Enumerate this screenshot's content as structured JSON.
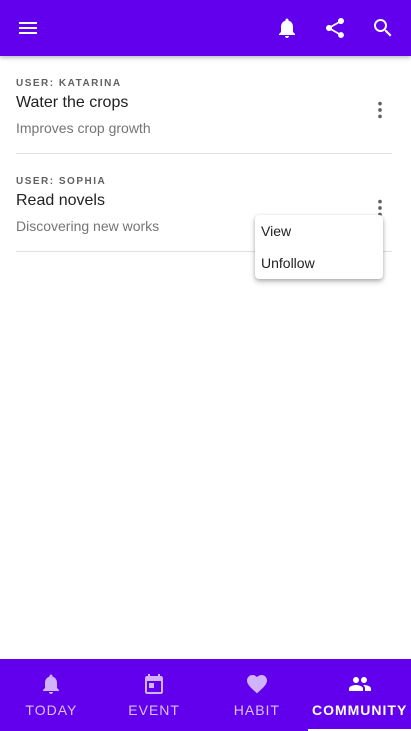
{
  "appbar": {
    "icons": [
      "menu-icon",
      "bell-icon",
      "share-icon",
      "search-icon"
    ],
    "color": "#6200ee"
  },
  "cards": [
    {
      "user": "USER: KATARINA",
      "title": "Water the crops",
      "subtitle": "Improves crop growth"
    },
    {
      "user": "USER: SOPHIA",
      "title": "Read novels",
      "subtitle": "Discovering new works"
    }
  ],
  "popup_menu": {
    "items": [
      "View",
      "Unfollow"
    ]
  },
  "bottom_nav": {
    "items": [
      {
        "label": "TODAY",
        "icon": "bell-icon"
      },
      {
        "label": "EVENT",
        "icon": "calendar-icon"
      },
      {
        "label": "HABIT",
        "icon": "heart-icon"
      },
      {
        "label": "COMMUNITY",
        "icon": "people-icon"
      }
    ],
    "active": "COMMUNITY"
  }
}
